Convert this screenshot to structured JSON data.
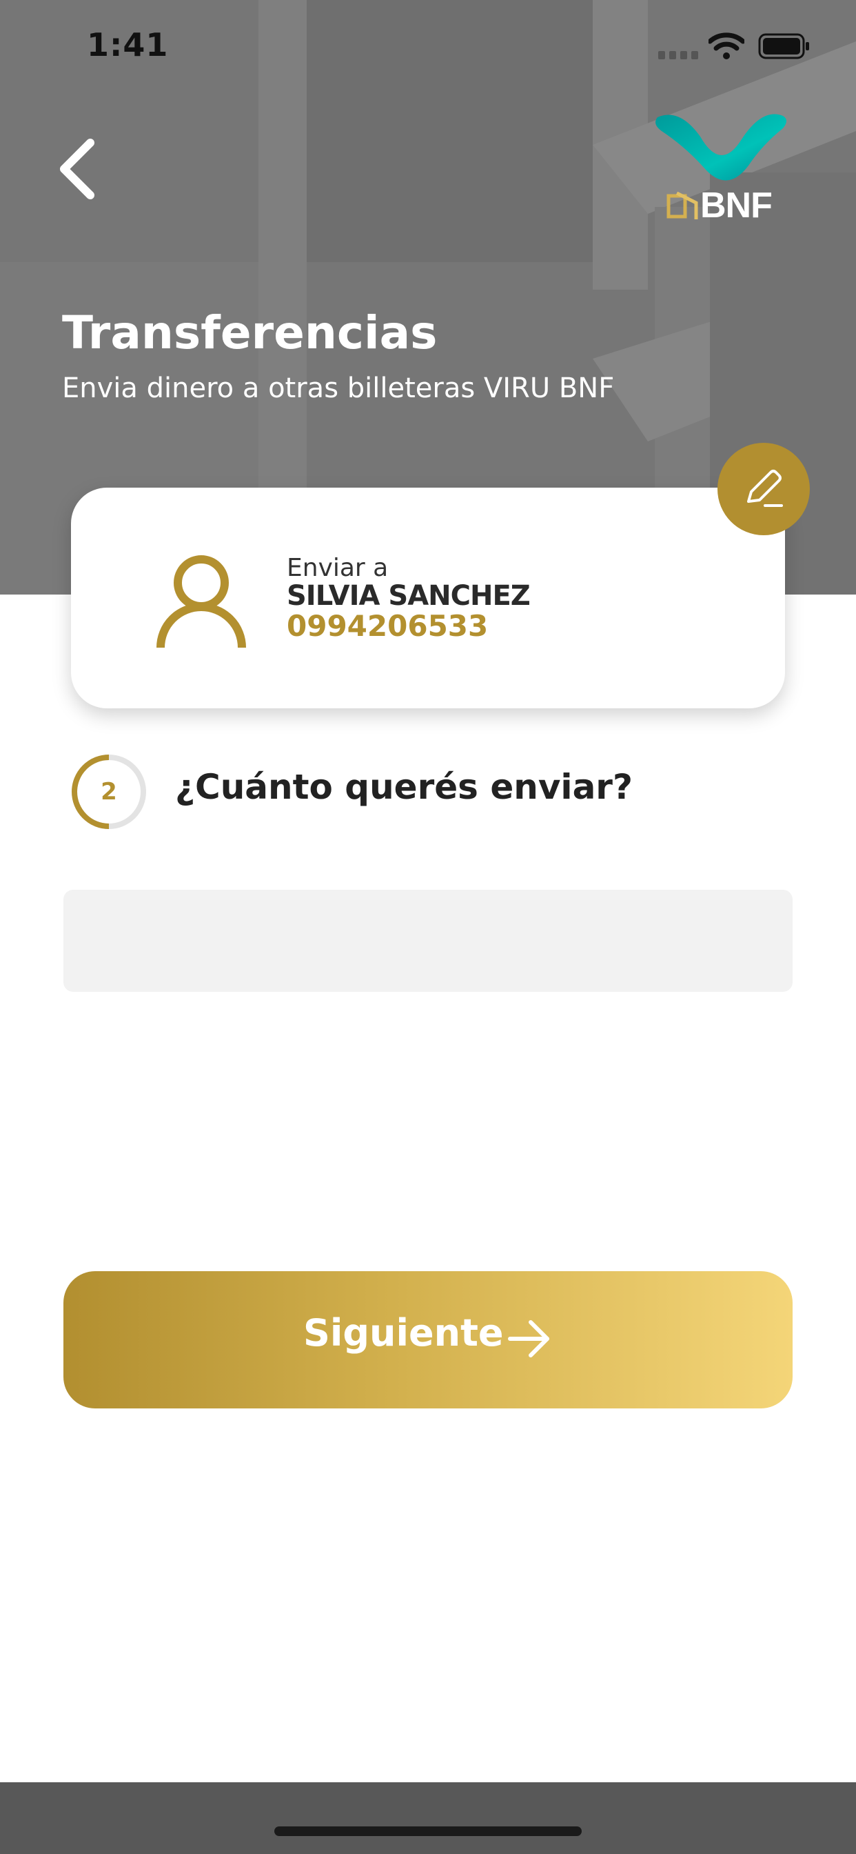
{
  "status_bar": {
    "time": "1:41"
  },
  "header": {
    "title": "Transferencias",
    "subtitle": "Envia dinero a otras billeteras VIRU BNF",
    "logo_text": "BNF"
  },
  "recipient": {
    "label": "Enviar a",
    "name": "SILVIA SANCHEZ",
    "phone": "0994206533"
  },
  "step": {
    "number": "2",
    "question": "¿Cuánto querés enviar?"
  },
  "amount_input": {
    "value": "",
    "placeholder": ""
  },
  "next_button": {
    "label": "Siguiente"
  },
  "icons": {
    "back": "chevron-left-icon",
    "edit": "pencil-icon",
    "avatar": "user-icon",
    "next": "arrow-right-icon"
  },
  "colors": {
    "accent_gold": "#b28f30",
    "accent_gold_light": "#f4d578",
    "logo_teal": "#00b0b0",
    "header_gray": "#767676"
  }
}
